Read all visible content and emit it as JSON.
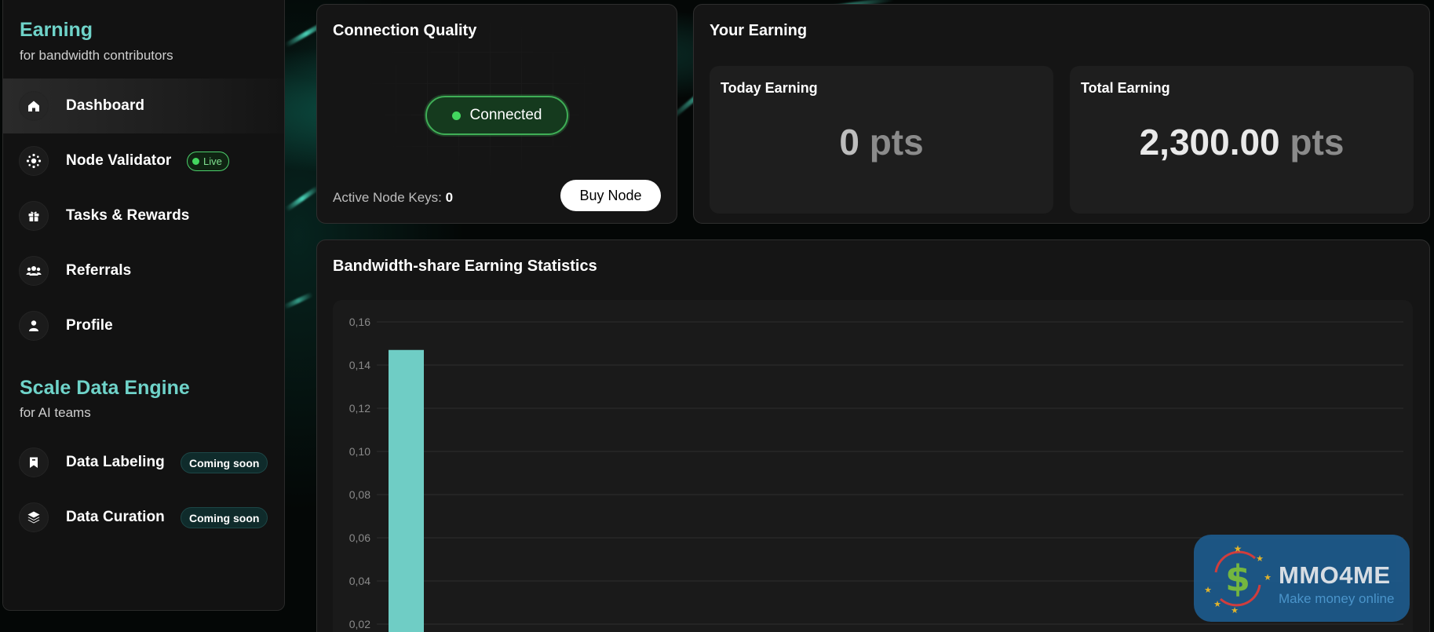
{
  "colors": {
    "accent": "#6fd3c9",
    "bar": "#6fcdc5",
    "live_green": "#43d65f",
    "card_bg": "#151515",
    "page_bg": "#050807"
  },
  "sidebar": {
    "earning_section": {
      "title": "Earning",
      "subtitle": "for bandwidth contributors",
      "items": [
        {
          "label": "Dashboard",
          "icon": "home-icon",
          "active": true
        },
        {
          "label": "Node Validator",
          "icon": "node-icon",
          "badge": "Live"
        },
        {
          "label": "Tasks & Rewards",
          "icon": "gift-icon"
        },
        {
          "label": "Referrals",
          "icon": "users-icon"
        },
        {
          "label": "Profile",
          "icon": "user-icon"
        }
      ]
    },
    "scale_section": {
      "title": "Scale Data Engine",
      "subtitle": "for AI teams",
      "items": [
        {
          "label": "Data Labeling",
          "icon": "bookmark-icon",
          "badge": "Coming soon"
        },
        {
          "label": "Data Curation",
          "icon": "layers-icon",
          "badge": "Coming soon"
        }
      ]
    }
  },
  "connection_card": {
    "title": "Connection Quality",
    "status": "Connected",
    "active_keys_label": "Active Node Keys:",
    "active_keys_value": "0",
    "buy_button": "Buy Node"
  },
  "earning_card": {
    "title": "Your Earning",
    "today": {
      "label": "Today Earning",
      "value": "0",
      "unit": "pts"
    },
    "total": {
      "label": "Total Earning",
      "value": "2,300.00",
      "unit": "pts"
    }
  },
  "stats_card": {
    "title": "Bandwidth-share Earning Statistics"
  },
  "chart_data": {
    "type": "bar",
    "title": "Bandwidth-share Earning Statistics",
    "ylim": [
      0,
      0.16
    ],
    "yticks": [
      "0,16",
      "0,14",
      "0,12",
      "0,10",
      "0,08",
      "0,06",
      "0,04",
      "0,02"
    ],
    "grid": true,
    "series": [
      {
        "values": [
          0.147
        ]
      }
    ]
  },
  "watermark": {
    "name": "MMO4ME",
    "tagline": "Make money online"
  }
}
